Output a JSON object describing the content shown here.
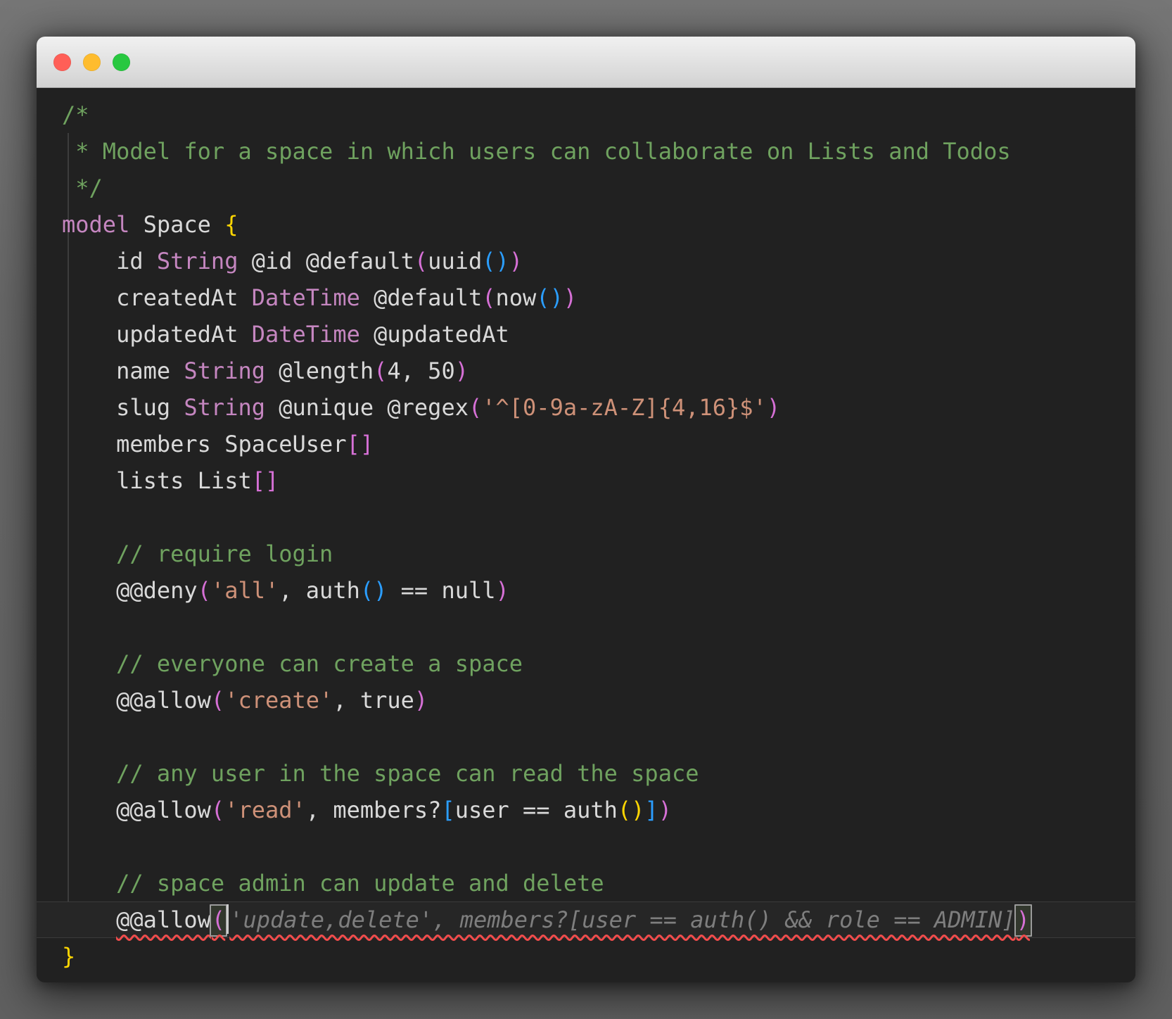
{
  "window": {
    "traffic_lights": [
      {
        "name": "close",
        "color": "#ff5f57"
      },
      {
        "name": "minimize",
        "color": "#febc2e"
      },
      {
        "name": "zoom",
        "color": "#28c840"
      }
    ]
  },
  "colors": {
    "editor-bg": "#212121",
    "titlebar-top": "#f1f1f1",
    "titlebar-bottom": "#d2d2d2",
    "comment": "#6fa25f",
    "ident": "#d9d9d9",
    "keyword": "#c586c0",
    "string": "#ce9178",
    "b1": "#ffd602",
    "b2": "#d670d6",
    "b3": "#2b9eff",
    "ghost": "#7e7e7e",
    "caret": "#cccccc",
    "squiggle": "#f14c4c",
    "guide": "#3d3d3d",
    "current-line-bg": "#262626",
    "current-line-border": "#3a3a3a"
  },
  "editor": {
    "lines": [
      {
        "tokens": [
          {
            "t": "/*",
            "c": "comment"
          }
        ]
      },
      {
        "tokens": [
          {
            "t": " * Model for a space in which users can collaborate on Lists and Todos",
            "c": "comment"
          }
        ]
      },
      {
        "tokens": [
          {
            "t": " */",
            "c": "comment"
          }
        ]
      },
      {
        "tokens": [
          {
            "t": "model ",
            "c": "keyword"
          },
          {
            "t": "Space ",
            "c": "ident"
          },
          {
            "t": "{",
            "c": "b1"
          }
        ]
      },
      {
        "tokens": [
          {
            "t": "    id ",
            "c": "ident"
          },
          {
            "t": "String",
            "c": "type"
          },
          {
            "t": " @id @default",
            "c": "ident"
          },
          {
            "t": "(",
            "c": "b2"
          },
          {
            "t": "uuid",
            "c": "ident"
          },
          {
            "t": "()",
            "c": "b3"
          },
          {
            "t": ")",
            "c": "b2"
          }
        ]
      },
      {
        "tokens": [
          {
            "t": "    createdAt ",
            "c": "ident"
          },
          {
            "t": "DateTime",
            "c": "type"
          },
          {
            "t": " @default",
            "c": "ident"
          },
          {
            "t": "(",
            "c": "b2"
          },
          {
            "t": "now",
            "c": "ident"
          },
          {
            "t": "()",
            "c": "b3"
          },
          {
            "t": ")",
            "c": "b2"
          }
        ]
      },
      {
        "tokens": [
          {
            "t": "    updatedAt ",
            "c": "ident"
          },
          {
            "t": "DateTime",
            "c": "type"
          },
          {
            "t": " @updatedAt",
            "c": "ident"
          }
        ]
      },
      {
        "tokens": [
          {
            "t": "    name ",
            "c": "ident"
          },
          {
            "t": "String",
            "c": "type"
          },
          {
            "t": " @length",
            "c": "ident"
          },
          {
            "t": "(",
            "c": "b2"
          },
          {
            "t": "4, 50",
            "c": "ident"
          },
          {
            "t": ")",
            "c": "b2"
          }
        ]
      },
      {
        "tokens": [
          {
            "t": "    slug ",
            "c": "ident"
          },
          {
            "t": "String",
            "c": "type"
          },
          {
            "t": " @unique @regex",
            "c": "ident"
          },
          {
            "t": "(",
            "c": "b2"
          },
          {
            "t": "'^[0-9a-zA-Z]{4,16}$'",
            "c": "string"
          },
          {
            "t": ")",
            "c": "b2"
          }
        ]
      },
      {
        "tokens": [
          {
            "t": "    members SpaceUser",
            "c": "ident"
          },
          {
            "t": "[]",
            "c": "b2"
          }
        ]
      },
      {
        "tokens": [
          {
            "t": "    lists List",
            "c": "ident"
          },
          {
            "t": "[]",
            "c": "b2"
          }
        ]
      },
      {
        "tokens": []
      },
      {
        "tokens": [
          {
            "t": "    ",
            "c": "ident"
          },
          {
            "t": "// require login",
            "c": "comment"
          }
        ]
      },
      {
        "tokens": [
          {
            "t": "    @@deny",
            "c": "ident"
          },
          {
            "t": "(",
            "c": "b2"
          },
          {
            "t": "'all'",
            "c": "string"
          },
          {
            "t": ", auth",
            "c": "ident"
          },
          {
            "t": "()",
            "c": "b3"
          },
          {
            "t": " == null",
            "c": "ident"
          },
          {
            "t": ")",
            "c": "b2"
          }
        ]
      },
      {
        "tokens": []
      },
      {
        "tokens": [
          {
            "t": "    ",
            "c": "ident"
          },
          {
            "t": "// everyone can create a space",
            "c": "comment"
          }
        ]
      },
      {
        "tokens": [
          {
            "t": "    @@allow",
            "c": "ident"
          },
          {
            "t": "(",
            "c": "b2"
          },
          {
            "t": "'create'",
            "c": "string"
          },
          {
            "t": ", true",
            "c": "ident"
          },
          {
            "t": ")",
            "c": "b2"
          }
        ]
      },
      {
        "tokens": []
      },
      {
        "tokens": [
          {
            "t": "    ",
            "c": "ident"
          },
          {
            "t": "// any user in the space can read the space",
            "c": "comment"
          }
        ]
      },
      {
        "tokens": [
          {
            "t": "    @@allow",
            "c": "ident"
          },
          {
            "t": "(",
            "c": "b2"
          },
          {
            "t": "'read'",
            "c": "string"
          },
          {
            "t": ", members?",
            "c": "ident"
          },
          {
            "t": "[",
            "c": "b3"
          },
          {
            "t": "user == auth",
            "c": "ident"
          },
          {
            "t": "()",
            "c": "b1"
          },
          {
            "t": "]",
            "c": "b3"
          },
          {
            "t": ")",
            "c": "b2"
          }
        ]
      },
      {
        "tokens": []
      },
      {
        "tokens": [
          {
            "t": "    ",
            "c": "ident"
          },
          {
            "t": "// space admin can update and delete",
            "c": "comment"
          }
        ]
      },
      {
        "current": true,
        "tokens": [
          {
            "t": "    ",
            "c": "ident"
          },
          {
            "c": "sq",
            "n": "error-squiggle",
            "k": [
              {
                "t": "@@allow",
                "c": "ident"
              },
              {
                "t": "(",
                "c": "b2 boxed",
                "n": "bracket-match-open"
              },
              {
                "c": "caret",
                "n": "text-cursor"
              },
              {
                "t": "'update,delete', members?[user == auth() && role == ADMIN]",
                "c": "ghost",
                "n": "inline-suggestion"
              },
              {
                "t": ")",
                "c": "b2 boxed",
                "n": "bracket-match-close"
              }
            ]
          }
        ]
      },
      {
        "tokens": [
          {
            "t": "}",
            "c": "b1"
          }
        ]
      }
    ]
  }
}
